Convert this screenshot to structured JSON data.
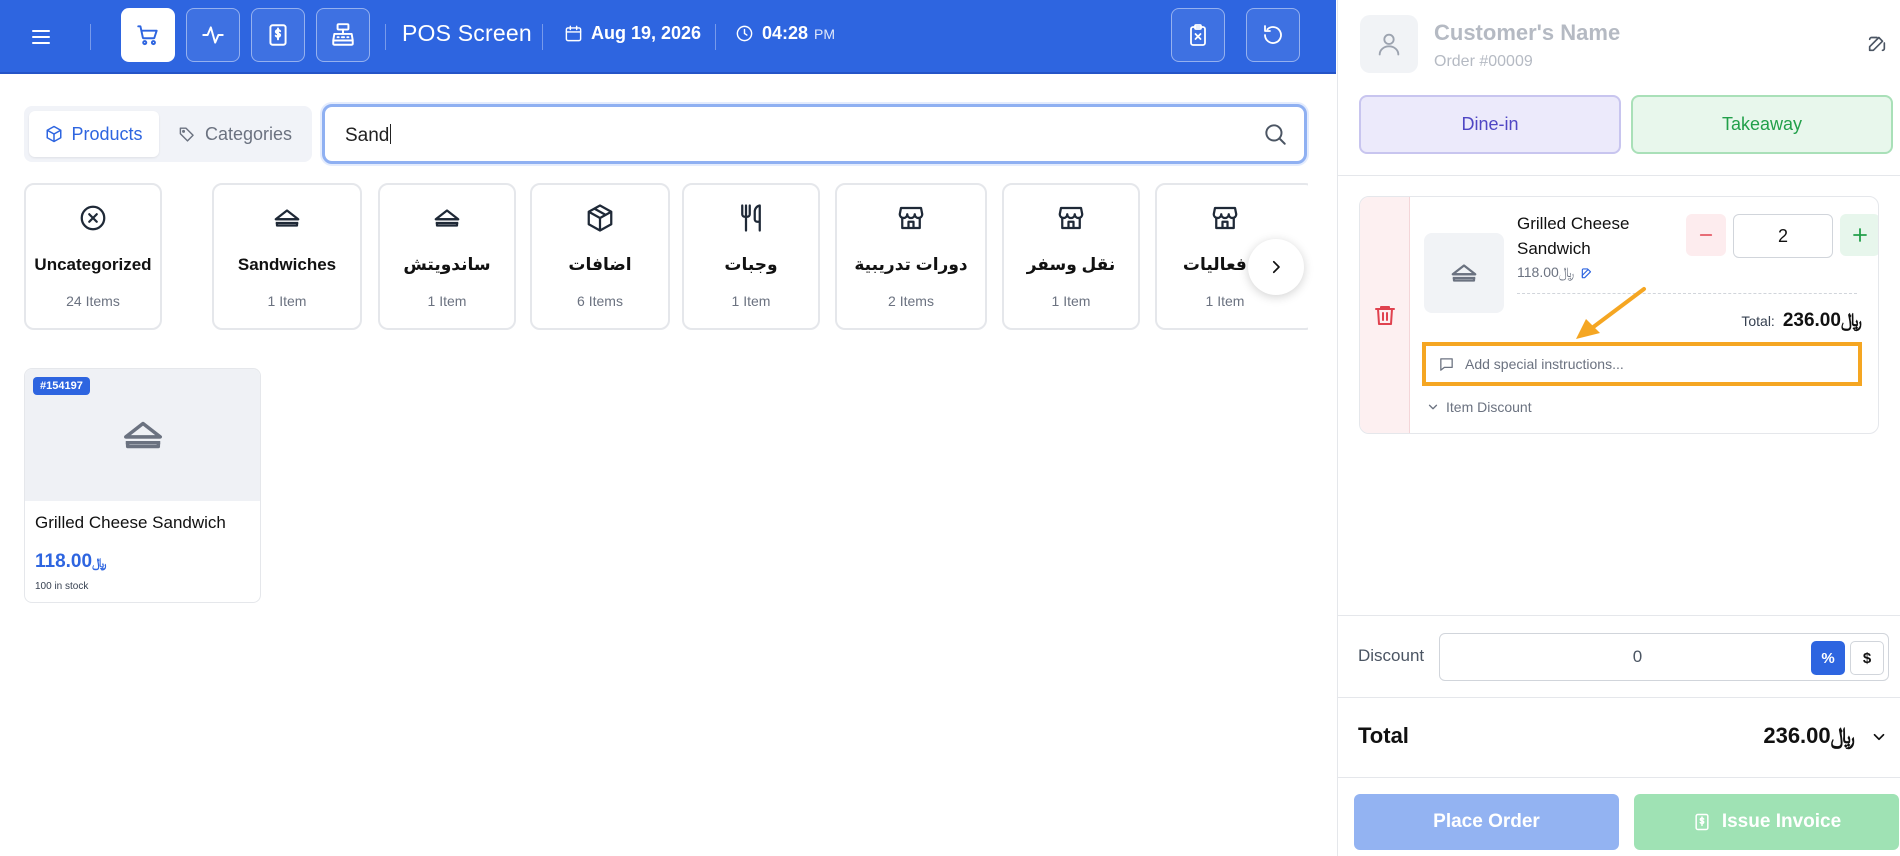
{
  "topbar": {
    "title": "POS Screen",
    "date": "Aug 19, 2026",
    "time": "04:28",
    "ampm": "PM"
  },
  "tabs": {
    "products": "Products",
    "categories": "Categories"
  },
  "search": {
    "value": "Sand"
  },
  "categories": [
    {
      "name": "Uncategorized",
      "count": "24 Items",
      "icon": "x-circle-icon"
    },
    {
      "name": "Sandwiches",
      "count": "1 Item",
      "icon": "sandwich-icon"
    },
    {
      "name": "ساندويتش",
      "count": "1 Item",
      "icon": "sandwich-icon"
    },
    {
      "name": "اضافات",
      "count": "6 Items",
      "icon": "box-icon"
    },
    {
      "name": "وجبات",
      "count": "1 Item",
      "icon": "utensils-icon"
    },
    {
      "name": "دورات تدريبية",
      "count": "2 Items",
      "icon": "store-icon"
    },
    {
      "name": "نقل وسفر",
      "count": "1 Item",
      "icon": "store-icon"
    },
    {
      "name": "ي فعاليات",
      "count": "1 Item",
      "icon": "store-icon"
    }
  ],
  "product": {
    "sku": "#154197",
    "name": "Grilled Cheese Sandwich",
    "currency": "﷼",
    "price": "118.00",
    "stock": "100 in stock"
  },
  "customer": {
    "name": "Customer's Name",
    "order": "Order #00009"
  },
  "order_type": {
    "dine_in": "Dine-in",
    "takeaway": "Takeaway"
  },
  "line_item": {
    "name": "Grilled Cheese Sandwich",
    "currency": "﷼",
    "unit_price": "118.00",
    "quantity": "2",
    "total_label": "Total:",
    "total": "236.00",
    "instructions_placeholder": "Add special instructions...",
    "discount_toggle": "Item Discount"
  },
  "discount": {
    "label": "Discount",
    "value": "0",
    "pct": "%",
    "usd": "$"
  },
  "total": {
    "label": "Total",
    "currency": "﷼",
    "value": "236.00"
  },
  "actions": {
    "place_order": "Place Order",
    "issue_invoice": "Issue Invoice"
  },
  "colors": {
    "primary": "#2e65e0",
    "success": "#22a04a",
    "danger": "#e0424f",
    "highlight": "#f5a622"
  }
}
